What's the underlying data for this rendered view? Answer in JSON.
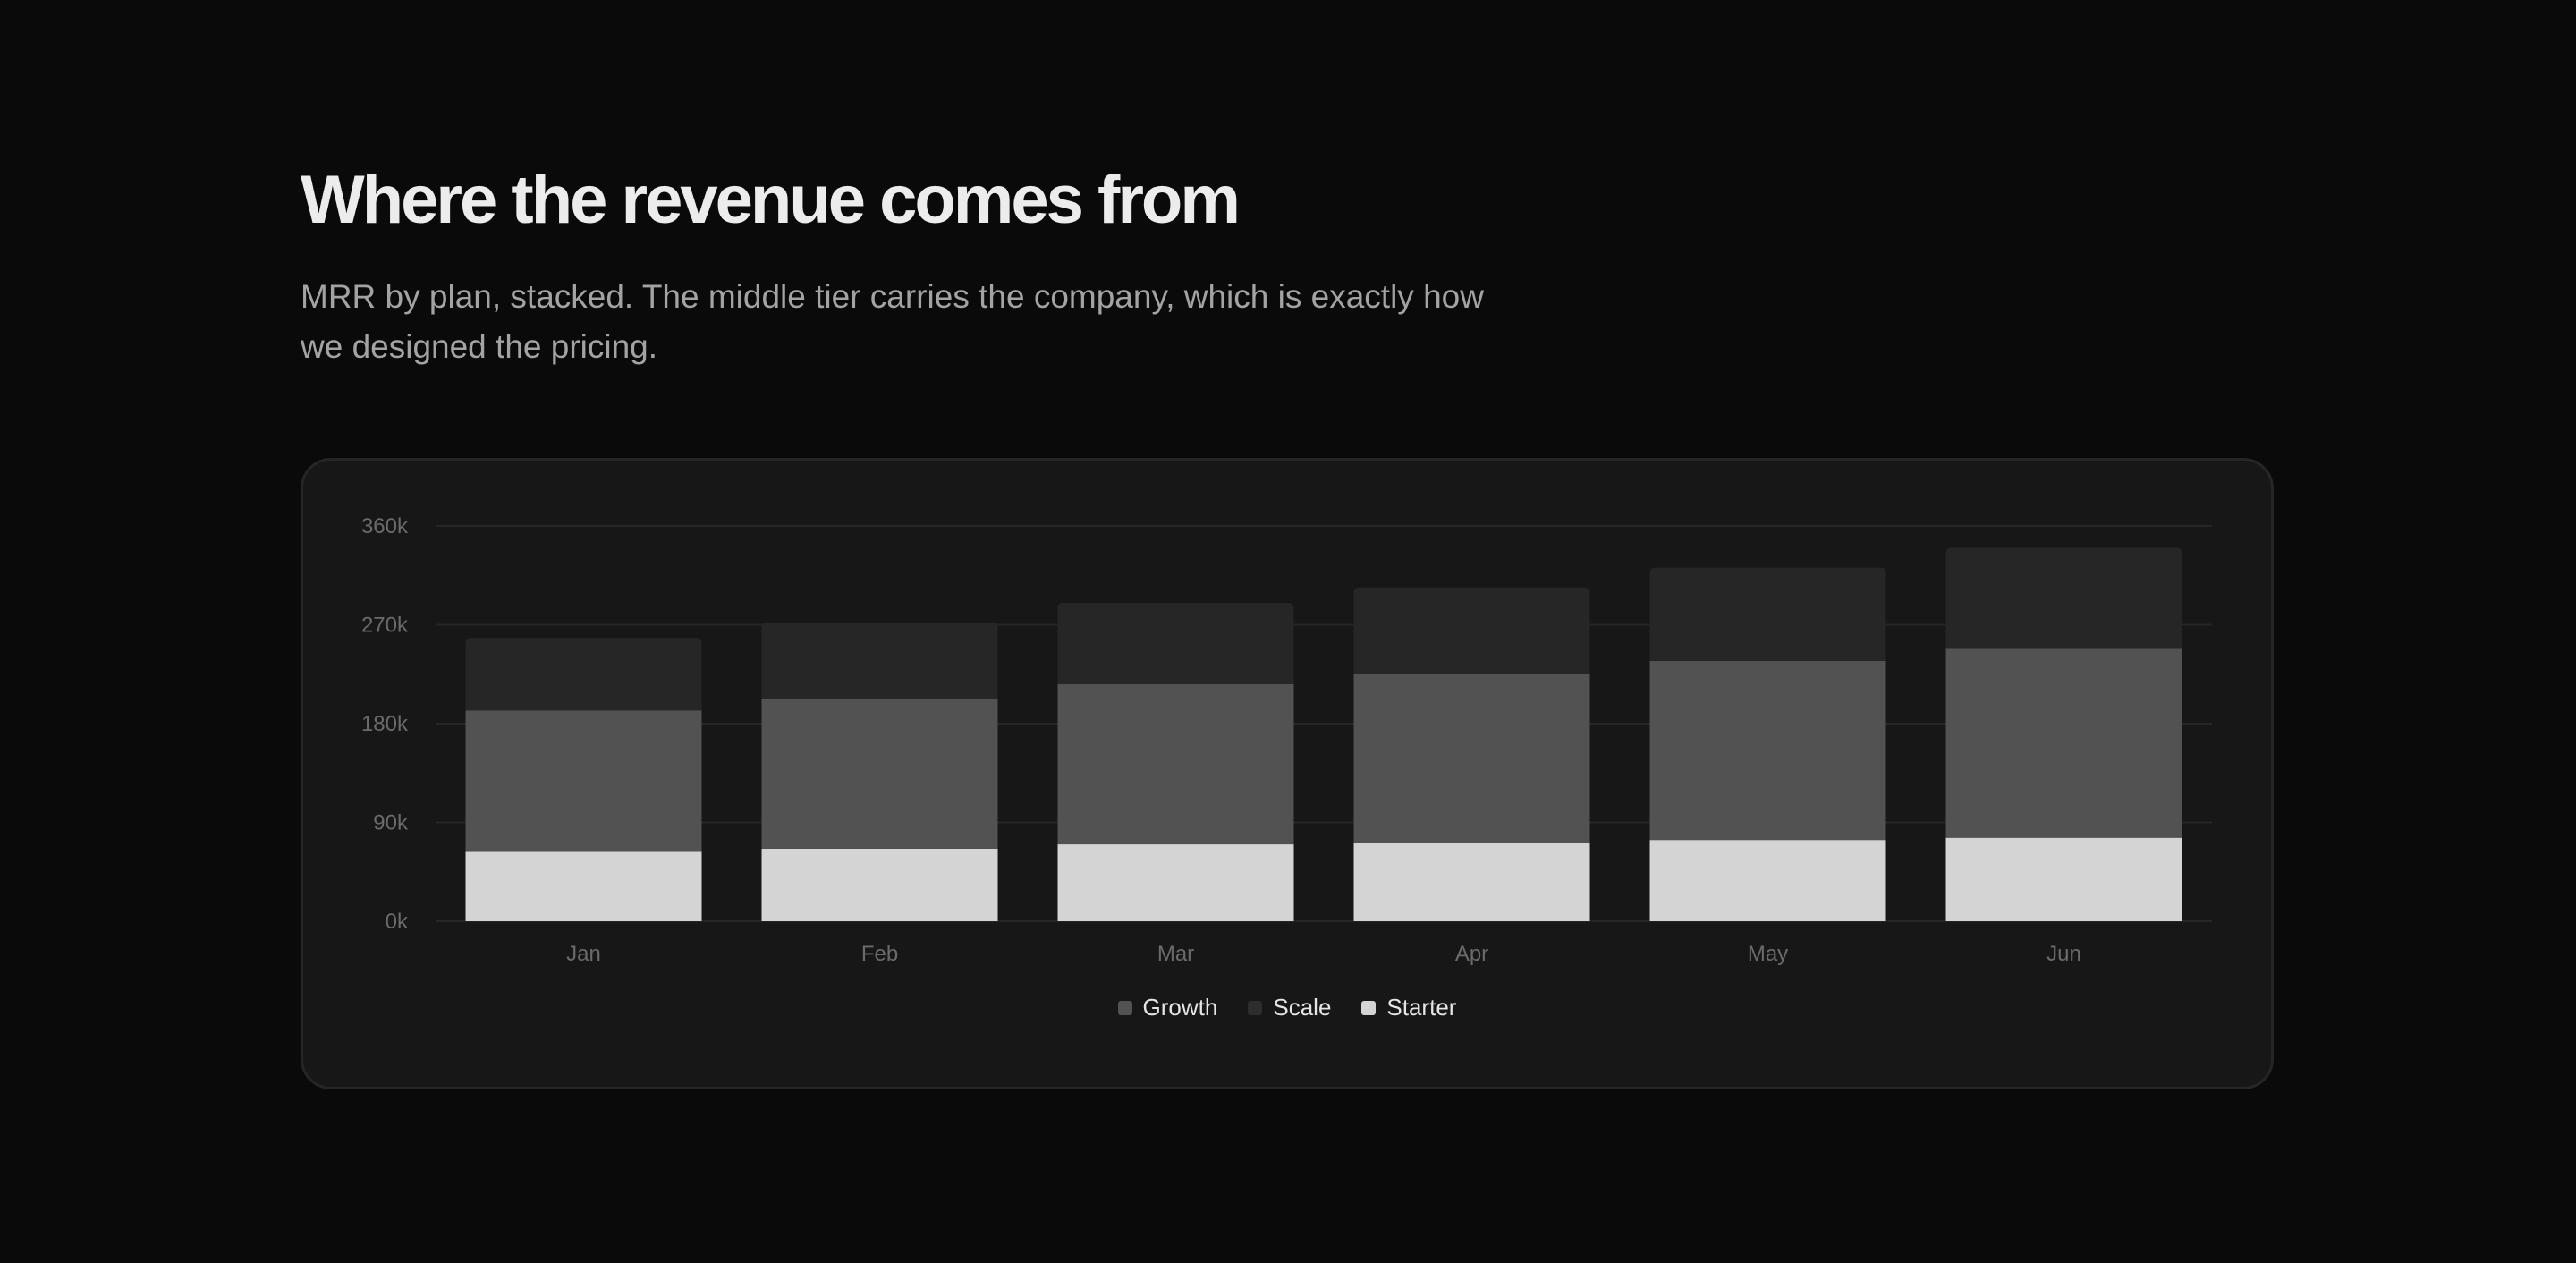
{
  "header": {
    "title": "Where the revenue comes from",
    "subtitle": "MRR by plan, stacked. The middle tier carries the company, which is exactly how we designed the pricing."
  },
  "colors": {
    "page_background": "#0a0a0a",
    "card_background": "#171717",
    "card_border": "#262626",
    "grid": "#262626",
    "tick_text": "#6b6b6b",
    "legend_text": "#e5e5e5"
  },
  "chart_data": {
    "type": "bar",
    "stacked": true,
    "categories": [
      "Jan",
      "Feb",
      "Mar",
      "Apr",
      "May",
      "Jun"
    ],
    "series": [
      {
        "name": "Starter",
        "color": "#d4d4d4",
        "values": [
          64000,
          66000,
          70000,
          71000,
          74000,
          76000
        ]
      },
      {
        "name": "Growth",
        "color": "#525252",
        "values": [
          128000,
          137000,
          146000,
          154000,
          163000,
          172000
        ]
      },
      {
        "name": "Scale",
        "color": "#262626",
        "values": [
          66000,
          69000,
          74000,
          79000,
          85000,
          92000
        ]
      }
    ],
    "legend_order": [
      "Growth",
      "Scale",
      "Starter"
    ],
    "yticks": [
      "0k",
      "90k",
      "180k",
      "270k",
      "360k"
    ],
    "ylim": [
      0,
      360000
    ],
    "grid": true,
    "legend_position": "bottom-center",
    "title": "",
    "xlabel": "",
    "ylabel": ""
  }
}
